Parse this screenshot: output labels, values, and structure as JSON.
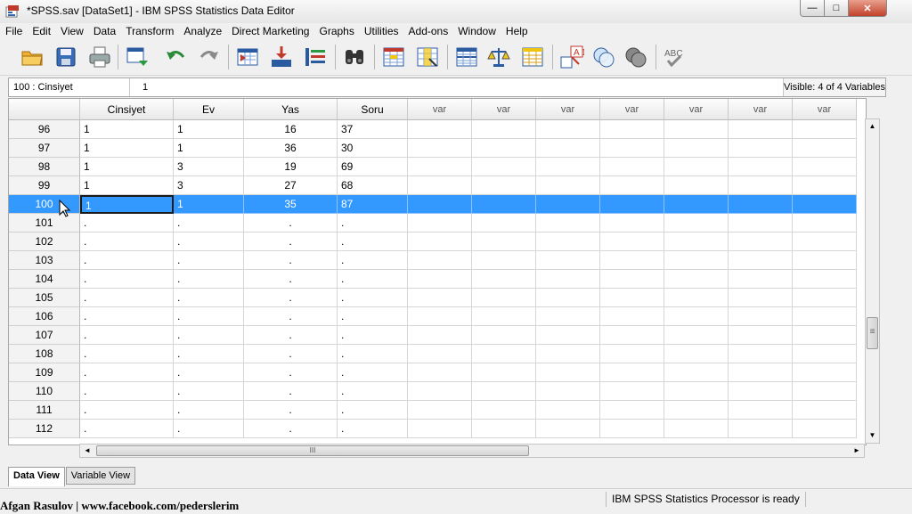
{
  "window": {
    "title": "*SPSS.sav [DataSet1] - IBM SPSS Statistics Data Editor",
    "minimize_glyph": "—",
    "maximize_glyph": "□",
    "close_glyph": "✕"
  },
  "menu": [
    "File",
    "Edit",
    "View",
    "Data",
    "Transform",
    "Analyze",
    "Direct Marketing",
    "Graphs",
    "Utilities",
    "Add-ons",
    "Window",
    "Help"
  ],
  "toolbar": {
    "icons": [
      "open-folder-icon",
      "save-icon",
      "print-icon",
      "dialog-recall-icon",
      "undo-icon",
      "redo-icon",
      "go-to-case-icon",
      "go-to-variable-icon",
      "variables-icon",
      "find-icon",
      "insert-cases-icon",
      "insert-variable-icon",
      "split-file-icon",
      "weight-cases-icon",
      "select-cases-icon",
      "value-labels-icon",
      "use-variable-sets-icon",
      "show-all-variables-icon",
      "spell-check-icon"
    ],
    "value_labels_text": "A 1",
    "spell_check_text": "ABC"
  },
  "cell_editor": {
    "reference": "100 : Cinsiyet",
    "value": "1",
    "visible": "Visible: 4 of 4 Variables"
  },
  "grid": {
    "columns": [
      "Cinsiyet",
      "Ev",
      "Yas",
      "Soru",
      "var",
      "var",
      "var",
      "var",
      "var",
      "var",
      "var"
    ],
    "rows": [
      {
        "id": "96",
        "values": [
          "1",
          "1",
          "16",
          "37"
        ]
      },
      {
        "id": "97",
        "values": [
          "1",
          "1",
          "36",
          "30"
        ]
      },
      {
        "id": "98",
        "values": [
          "1",
          "3",
          "19",
          "69"
        ]
      },
      {
        "id": "99",
        "values": [
          "1",
          "3",
          "27",
          "68"
        ]
      },
      {
        "id": "100",
        "values": [
          "1",
          "1",
          "35",
          "87"
        ],
        "selected": true
      },
      {
        "id": "101",
        "values": [
          ".",
          ".",
          ".",
          "."
        ]
      },
      {
        "id": "102",
        "values": [
          ".",
          ".",
          ".",
          "."
        ]
      },
      {
        "id": "103",
        "values": [
          ".",
          ".",
          ".",
          "."
        ]
      },
      {
        "id": "104",
        "values": [
          ".",
          ".",
          ".",
          "."
        ]
      },
      {
        "id": "105",
        "values": [
          ".",
          ".",
          ".",
          "."
        ]
      },
      {
        "id": "106",
        "values": [
          ".",
          ".",
          ".",
          "."
        ]
      },
      {
        "id": "107",
        "values": [
          ".",
          ".",
          ".",
          "."
        ]
      },
      {
        "id": "108",
        "values": [
          ".",
          ".",
          ".",
          "."
        ]
      },
      {
        "id": "109",
        "values": [
          ".",
          ".",
          ".",
          "."
        ]
      },
      {
        "id": "110",
        "values": [
          ".",
          ".",
          ".",
          "."
        ]
      },
      {
        "id": "111",
        "values": [
          ".",
          ".",
          ".",
          "."
        ]
      },
      {
        "id": "112",
        "values": [
          ".",
          ".",
          ".",
          "."
        ]
      }
    ]
  },
  "scroll": {
    "up": "▲",
    "down": "▼",
    "left": "◄",
    "right": "►",
    "grip_v": "≡",
    "grip_h": "III"
  },
  "tabs": [
    {
      "label": "Data View",
      "active": true
    },
    {
      "label": "Variable View",
      "active": false
    }
  ],
  "status": "IBM SPSS Statistics Processor is ready",
  "watermark": "Afgan Rasulov | www.facebook.com/pederslerim"
}
